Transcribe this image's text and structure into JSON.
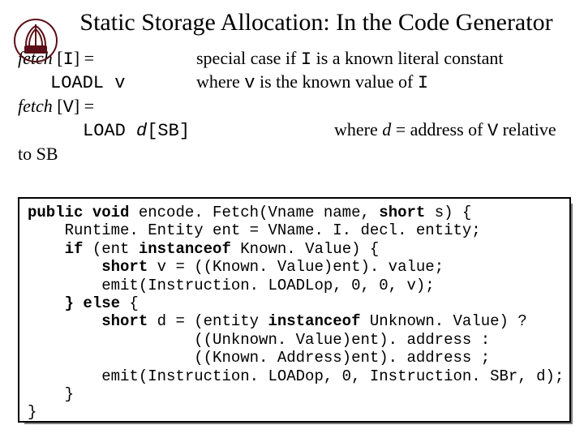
{
  "title": "Static Storage Allocation: In the Code Generator",
  "spec": {
    "l1_lhs_pre": "fetch",
    "l1_lhs_br_open": " [",
    "l1_lhs_I": "I",
    "l1_lhs_br_close": "] =",
    "l1_rhs_a": "special case if ",
    "l1_rhs_I": "I",
    "l1_rhs_b": "  is a known literal constant",
    "l2_lhs": "LOADL v",
    "l2_rhs_a": "where ",
    "l2_rhs_v": "v",
    "l2_rhs_b": " is the known value of ",
    "l2_rhs_I": "I",
    "l3_lhs_pre": "fetch",
    "l3_lhs_br_open": " [",
    "l3_lhs_V": "V",
    "l3_lhs_br_close": "] =",
    "l4_lhs_a": "LOAD ",
    "l4_lhs_d": "d",
    "l4_lhs_b": "[SB]",
    "l4_rhs_a": "where ",
    "l4_rhs_d": "d",
    "l4_rhs_b": " = address of ",
    "l4_rhs_V": "V",
    "l4_rhs_c": " relative",
    "l5": "to SB"
  },
  "code": {
    "kw_public": "public",
    "kw_void": " void",
    "sig": " encode. Fetch(Vname name, ",
    "kw_short1": "short",
    "sig2": " s) {",
    "l2": "    Runtime. Entity ent = VName. I. decl. entity;",
    "kw_if": "    if",
    "l3a": " (ent ",
    "kw_inst1": "instanceof",
    "l3b": " Known. Value) {",
    "kw_short2": "        short",
    "l4": " v = ((Known. Value)ent). value;",
    "l5": "        emit(Instruction. LOADLop, 0, 0, v);",
    "kw_else": "    } else",
    "l6": " {",
    "kw_short3": "        short",
    "l7a": " d = (entity ",
    "kw_inst2": "instanceof",
    "l7b": " Unknown. Value) ?",
    "l8": "                  ((Unknown. Value)ent). address :",
    "l9": "                  ((Known. Address)ent). address ;",
    "l10": "        emit(Instruction. LOADop, 0, Instruction. SBr, d);",
    "l11": "    }",
    "l12": "}"
  }
}
